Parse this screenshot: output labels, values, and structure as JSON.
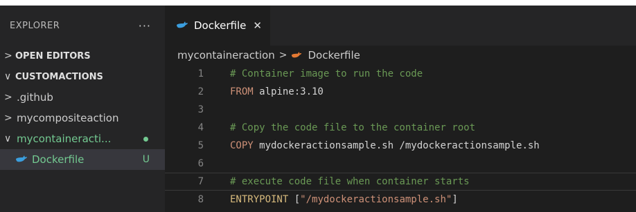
{
  "explorer": {
    "title": "EXPLORER",
    "more": "···",
    "sections": [
      {
        "label": "OPEN EDITORS",
        "chevron": ">"
      },
      {
        "label": "CUSTOMACTIONS",
        "chevron": "∨"
      }
    ],
    "items": [
      {
        "label": ".github",
        "chevron": ">"
      },
      {
        "label": "mycompositeaction",
        "chevron": ">"
      },
      {
        "label": "mycontaineracti...",
        "chevron": "∨"
      },
      {
        "label": "Dockerfile",
        "badge": "U"
      }
    ]
  },
  "tab": {
    "label": "Dockerfile",
    "close": "✕"
  },
  "breadcrumb": {
    "folder": "mycontaineraction",
    "sep": ">",
    "file": "Dockerfile"
  },
  "code": {
    "lines": [
      {
        "num": "1",
        "comment": "# Container image to run the code"
      },
      {
        "num": "2",
        "kw": "FROM",
        "rest": " alpine:3.10"
      },
      {
        "num": "3"
      },
      {
        "num": "4",
        "comment": "# Copy the code file to the container root"
      },
      {
        "num": "5",
        "kw": "COPY",
        "rest": " mydockeractionsample.sh /mydockeractionsample.sh"
      },
      {
        "num": "6"
      },
      {
        "num": "7",
        "comment": "# execute code file when container starts"
      },
      {
        "num": "8",
        "kw": "ENTRYPOINT",
        "rest": " [",
        "str": "\"/mydockeractionsample.sh\"",
        "rest2": "]"
      }
    ]
  },
  "colors": {
    "whale": "#3b9ede",
    "modified_green": "#73c991",
    "breadcrumb_icon": "#e37933"
  },
  "icons": {
    "dockerfile": "docker-whale-icon"
  }
}
